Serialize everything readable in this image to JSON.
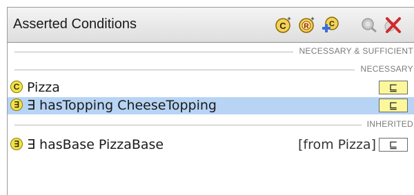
{
  "panel": {
    "title": "Asserted Conditions",
    "toolbar": [
      {
        "name": "add-necessary-superclass-icon",
        "glyph": "C"
      },
      {
        "name": "add-restriction-icon",
        "glyph": "R"
      },
      {
        "name": "add-expression-icon",
        "glyph": "C"
      },
      {
        "name": "find-icon"
      },
      {
        "name": "delete-icon"
      }
    ]
  },
  "sections": {
    "necessary_sufficient": "NECESSARY & SUFFICIENT",
    "necessary": "NECESSARY",
    "inherited": "INHERITED"
  },
  "rows": [
    {
      "badge": "C",
      "text": "Pizza",
      "subset": "⊑",
      "selected": false
    },
    {
      "badge": "∃",
      "text": "∃ hasTopping CheeseTopping",
      "subset": "⊑",
      "selected": true
    },
    {
      "badge": "∃",
      "text": "∃ hasBase PizzaBase",
      "origin": "[from Pizza]",
      "subset": "⊑",
      "selected": false
    }
  ],
  "colors": {
    "selection": "#b7d4f4",
    "badge": "#f2e24a",
    "subset_highlight": "#fbf79a"
  }
}
